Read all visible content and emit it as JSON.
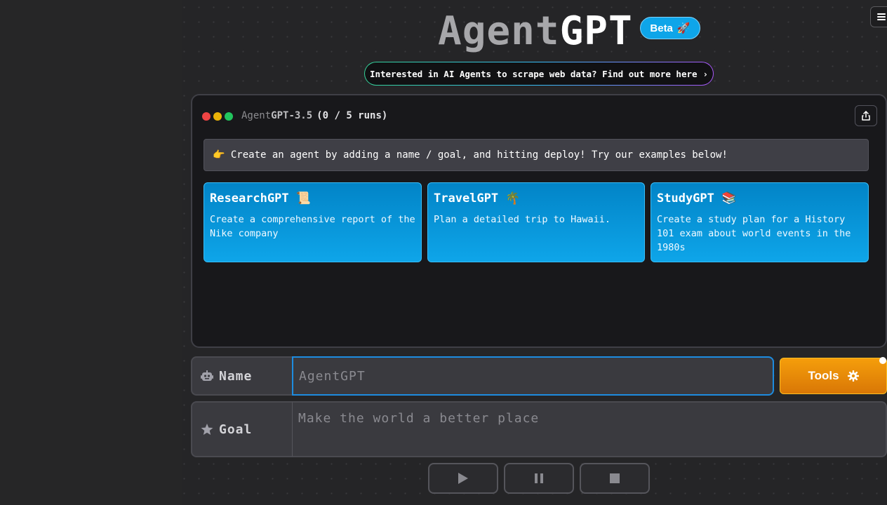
{
  "header": {
    "logo_part1": "Agent",
    "logo_part2": "GPT",
    "beta_label": "Beta",
    "beta_emoji": "🚀",
    "banner_text": "Interested in AI Agents to scrape web data? Find out more here",
    "banner_chevron": "›"
  },
  "window": {
    "model_part1": "Agent",
    "model_part2": "GPT-3.5",
    "runs": "(0 / 5 runs)",
    "dot_colors": [
      "#ef4444",
      "#eab308",
      "#22c55e"
    ],
    "info_text": "👉 Create an agent by adding a name / goal, and hitting deploy! Try our examples below!",
    "examples": [
      {
        "title": "ResearchGPT 📜",
        "description": "Create a comprehensive report of the Nike company"
      },
      {
        "title": "TravelGPT 🌴",
        "description": "Plan a detailed trip to Hawaii."
      },
      {
        "title": "StudyGPT 📚",
        "description": "Create a study plan for a History 101 exam about world events in the 1980s"
      }
    ]
  },
  "form": {
    "name_label": "Name",
    "name_placeholder": "AgentGPT",
    "goal_label": "Goal",
    "goal_placeholder": "Make the world a better place",
    "tools_label": "Tools"
  },
  "colors": {
    "accent_blue": "#0ea5e9",
    "tools_orange": "#f59e0b"
  },
  "icons": {
    "menu": "hamburger-menu-icon",
    "share": "share-icon",
    "name": "robot-icon",
    "goal": "star-icon",
    "tools": "gear-icon",
    "play": "play-icon",
    "pause": "pause-icon",
    "stop": "stop-icon"
  }
}
